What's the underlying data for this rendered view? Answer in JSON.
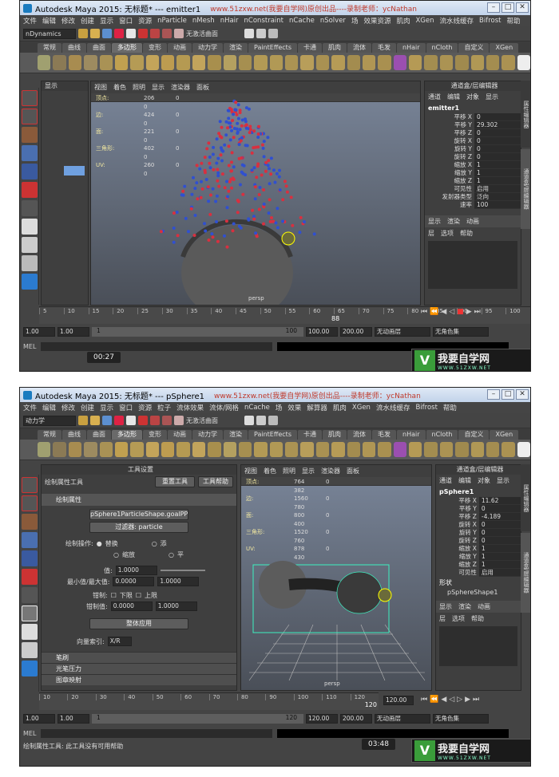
{
  "watermark": "www.51zxw.net(我要自学网)原创出品----录制老师：ycNathan",
  "site_logo": {
    "brand": "我要自学网",
    "url": "WWW.51ZXW.NET",
    "mark": "V"
  },
  "shot1": {
    "app_title": "Autodesk Maya 2015: 无标题*   ---   emitter1",
    "menus": [
      "文件",
      "编辑",
      "修改",
      "创建",
      "显示",
      "窗口",
      "资源",
      "nParticle",
      "nMesh",
      "nHair",
      "nConstraint",
      "nCache",
      "nSolver",
      "场",
      "效果资源",
      "肌肉",
      "XGen",
      "流水线缓存",
      "Bifrost",
      "帮助"
    ],
    "mode": "nDynamics",
    "status_text": "无激活曲面",
    "shelf_tabs": [
      "常规",
      "曲线",
      "曲面",
      "多边形",
      "变形",
      "动画",
      "动力学",
      "渲染",
      "PaintEffects",
      "卡通",
      "肌肉",
      "流体",
      "毛发",
      "nHair",
      "nCloth",
      "自定义",
      "XGen"
    ],
    "active_tab": "多边形",
    "left_panel_label": "显示",
    "viewport_menus": [
      "视图",
      "着色",
      "照明",
      "显示",
      "渲染器",
      "面板"
    ],
    "hud": [
      {
        "label": "顶点:",
        "a": "206",
        "b": "0",
        "c": "0"
      },
      {
        "label": "边:",
        "a": "424",
        "b": "0",
        "c": "0"
      },
      {
        "label": "面:",
        "a": "221",
        "b": "0",
        "c": "0"
      },
      {
        "label": "三角形:",
        "a": "402",
        "b": "0",
        "c": "0"
      },
      {
        "label": "UV:",
        "a": "260",
        "b": "0",
        "c": "0"
      }
    ],
    "camera_label": "persp",
    "channel_box_title": "通道盒/层编辑器",
    "channel_menus": [
      "通道",
      "编辑",
      "对象",
      "显示"
    ],
    "object_name": "emitter1",
    "channels": [
      {
        "name": "平移 X",
        "value": "0"
      },
      {
        "name": "平移 Y",
        "value": "29.302"
      },
      {
        "name": "平移 Z",
        "value": "0"
      },
      {
        "name": "旋转 X",
        "value": "0"
      },
      {
        "name": "旋转 Y",
        "value": "0"
      },
      {
        "name": "旋转 Z",
        "value": "0"
      },
      {
        "name": "缩放 X",
        "value": "1"
      },
      {
        "name": "缩放 Y",
        "value": "1"
      },
      {
        "name": "缩放 Z",
        "value": "1"
      },
      {
        "name": "可见性",
        "value": "启用"
      },
      {
        "name": "发射器类型",
        "value": "泛向"
      },
      {
        "name": "速率",
        "value": "100"
      }
    ],
    "layer_tabs": [
      "显示",
      "渲染",
      "动画"
    ],
    "layer_menus": [
      "层",
      "选项",
      "帮助"
    ],
    "right_tabs": [
      "属性编辑器",
      "通道盒/层编辑器"
    ],
    "timeline_ticks": [
      "5",
      "10",
      "15",
      "20",
      "25",
      "30",
      "35",
      "40",
      "45",
      "50",
      "55",
      "60",
      "65",
      "70",
      "75",
      "80",
      "85",
      "90",
      "95",
      "100"
    ],
    "current_frame": "88",
    "range": {
      "start": "1.00",
      "start2": "1.00",
      "inner_start": "1",
      "inner_end": "100",
      "end": "100.00",
      "end2": "200.00"
    },
    "anim_layer": "无动画层",
    "char_set": "无角色集",
    "mel_label": "MEL",
    "video_time": "00:27"
  },
  "shot2": {
    "app_title": "Autodesk Maya 2015: 无标题*   ---   pSphere1",
    "menus": [
      "文件",
      "编辑",
      "修改",
      "创建",
      "显示",
      "窗口",
      "资源",
      "粒子",
      "流体效果",
      "流体/网格",
      "nCache",
      "场",
      "效果",
      "解算器",
      "肌肉",
      "XGen",
      "流水线缓存",
      "Bifrost",
      "帮助"
    ],
    "mode": "动力学",
    "status_text": "无激活曲面",
    "shelf_tabs": [
      "常规",
      "曲线",
      "曲面",
      "多边形",
      "变形",
      "动画",
      "动力学",
      "渲染",
      "PaintEffects",
      "卡通",
      "肌肉",
      "流体",
      "毛发",
      "nHair",
      "nCloth",
      "自定义",
      "XGen"
    ],
    "active_tab": "多边形",
    "tool_settings_title": "工具设置",
    "tool_name": "绘制属性工具",
    "reset_button": "重置工具",
    "help_button": "工具帮助",
    "section_paint": "绘制属性",
    "attr_button": "pSphere1ParticleShape.goalPP",
    "filter_button": "过滤器: particle",
    "paint_op_label": "绘制操作:",
    "paint_ops": [
      "替换",
      "添",
      "缩放",
      "平"
    ],
    "value_label": "值:",
    "value": "1.0000",
    "minmax_label": "最小值/最大值:",
    "min": "0.0000",
    "max": "1.0000",
    "clamp_label": "钳制:",
    "clamp_low": "下限",
    "clamp_high": "上限",
    "clamp_value_label": "钳制值:",
    "clamp_min": "0.0000",
    "clamp_max": "1.0000",
    "flood_button": "整体应用",
    "vector_label": "向量索引:",
    "vector_value": "X/R",
    "sections": [
      "笔刷",
      "光笔压力",
      "图章映射"
    ],
    "viewport_menus": [
      "视图",
      "着色",
      "照明",
      "显示",
      "渲染器",
      "面板"
    ],
    "hud": [
      {
        "label": "顶点:",
        "a": "764",
        "b": "382",
        "c": "0"
      },
      {
        "label": "边:",
        "a": "1560",
        "b": "780",
        "c": "0"
      },
      {
        "label": "面:",
        "a": "800",
        "b": "400",
        "c": "0"
      },
      {
        "label": "三角形:",
        "a": "1520",
        "b": "760",
        "c": "0"
      },
      {
        "label": "UV:",
        "a": "878",
        "b": "430",
        "c": "0"
      }
    ],
    "camera_label": "persp",
    "channel_box_title": "通道盒/层编辑器",
    "channel_menus": [
      "通道",
      "编辑",
      "对象",
      "显示"
    ],
    "object_name": "pSphere1",
    "channels": [
      {
        "name": "平移 X",
        "value": "11.62"
      },
      {
        "name": "平移 Y",
        "value": "0"
      },
      {
        "name": "平移 Z",
        "value": "-4.189"
      },
      {
        "name": "旋转 X",
        "value": "0"
      },
      {
        "name": "旋转 Y",
        "value": "0"
      },
      {
        "name": "旋转 Z",
        "value": "0"
      },
      {
        "name": "缩放 X",
        "value": "1"
      },
      {
        "name": "缩放 Y",
        "value": "1"
      },
      {
        "name": "缩放 Z",
        "value": "1"
      },
      {
        "name": "可见性",
        "value": "启用"
      }
    ],
    "shapes_label": "形状",
    "shape_name": "pSphereShape1",
    "layer_tabs": [
      "显示",
      "渲染",
      "动画"
    ],
    "layer_menus": [
      "层",
      "选项",
      "帮助"
    ],
    "right_tabs": [
      "属性编辑器",
      "通道盒/层编辑器"
    ],
    "timeline_ticks": [
      "10",
      "20",
      "30",
      "40",
      "50",
      "60",
      "70",
      "80",
      "90",
      "100",
      "110",
      "120"
    ],
    "current_frame": "120",
    "current_frame_field": "120.00",
    "range": {
      "start": "1.00",
      "start2": "1.00",
      "inner_start": "1",
      "inner_end": "120",
      "end": "120.00",
      "end2": "200.00"
    },
    "anim_layer": "无动画层",
    "char_set": "无角色集",
    "mel_label": "MEL",
    "help_line": "绘制属性工具: 此工具没有可用帮助",
    "video_time": "03:48"
  }
}
